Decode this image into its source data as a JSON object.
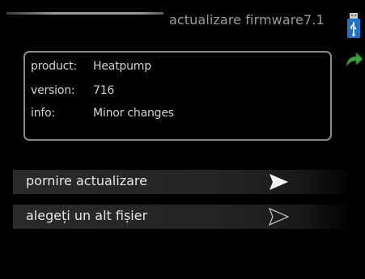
{
  "header": {
    "title": "actualizare firmware7.1",
    "icons": [
      "usb-icon",
      "back-arrow-icon"
    ]
  },
  "info": {
    "product_label": "product:",
    "product_value": "Heatpump",
    "version_label": "version:",
    "version_value": "716",
    "info_label": "info:",
    "info_value": "Minor changes"
  },
  "actions": [
    {
      "label": "pornire actualizare",
      "icon": "play-arrow-filled-icon"
    },
    {
      "label": "alegeți un alt fișier",
      "icon": "play-arrow-outline-icon"
    }
  ],
  "colors": {
    "background": "#000000",
    "accent_icon": "#1e73c8",
    "back_arrow": "#3aa23a"
  }
}
